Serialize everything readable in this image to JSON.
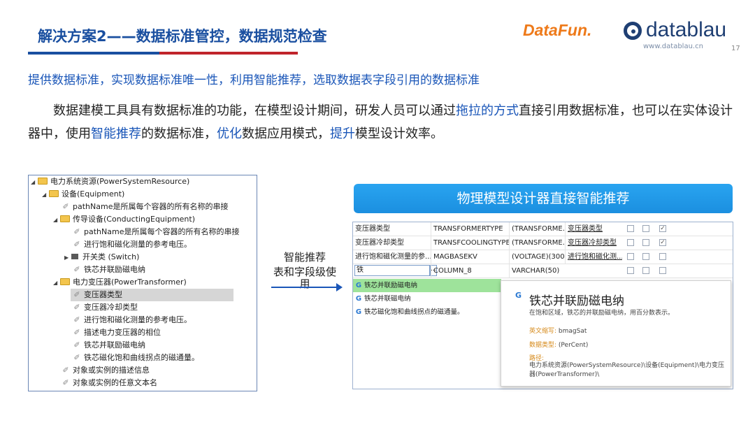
{
  "header": {
    "title": "解决方案2——数据标准管控，数据规范检查",
    "logo_datafun": "DataFun.",
    "logo_datablau": "datablau",
    "logo_url": "www.datablau.cn",
    "page_number": "17"
  },
  "subtitle": "提供数据标准，实现数据标准唯一性，利用智能推荐，选取数据表字段引用的数据标准",
  "paragraph": {
    "p1": "数据建模工具具有数据标准的功能，在模型设计期间，研发人员可以通过",
    "h1": "拖拉的方式",
    "p2": "直接引用数据标准，也可以在实体设计器中，使用",
    "h2": "智能推荐",
    "p3": "的数据标准，",
    "h3": "优化",
    "p4": "数据应用模式，",
    "h4": "提升",
    "p5": "模型设计效率。"
  },
  "tree": {
    "items": [
      {
        "label": "电力系统资源(PowerSystemResource)",
        "type": "folder",
        "expanded": true
      },
      {
        "label": "设备(Equipment)",
        "type": "folder",
        "expanded": true
      },
      {
        "label": "pathName是所属每个容器的所有名称的串接",
        "type": "leaf"
      },
      {
        "label": "传导设备(ConductingEquipment)",
        "type": "folder",
        "expanded": true
      },
      {
        "label": "pathName是所属每个容器的所有名称的串接",
        "type": "leaf"
      },
      {
        "label": "进行饱和磁化测量的参考电压。",
        "type": "leaf"
      },
      {
        "label": "开关类 (Switch)",
        "type": "folder-collapsed"
      },
      {
        "label": "铁芯并联励磁电纳",
        "type": "leaf"
      },
      {
        "label": "电力变压器(PowerTransformer)",
        "type": "folder",
        "expanded": true
      },
      {
        "label": "变压器类型",
        "type": "leaf",
        "selected": true
      },
      {
        "label": "变压器冷却类型",
        "type": "leaf"
      },
      {
        "label": "进行饱和磁化测量的参考电压。",
        "type": "leaf"
      },
      {
        "label": "描述电力变压器的相位",
        "type": "leaf"
      },
      {
        "label": "铁芯并联励磁电纳",
        "type": "leaf"
      },
      {
        "label": "铁芯磁化饱和曲线拐点的磁通量。",
        "type": "leaf"
      },
      {
        "label": "对象或实例的描述信息",
        "type": "leaf"
      },
      {
        "label": "对象或实例的任意文本名",
        "type": "leaf"
      }
    ]
  },
  "middle": {
    "line1": "智能推荐",
    "line2": "表和字段级使",
    "line3": "用"
  },
  "banner": "物理模型设计器直接智能推荐",
  "grid": {
    "rows": [
      {
        "name": "变压器类型",
        "column": "TRANSFORMERTYPE",
        "datatype": "(TRANSFORME...",
        "standard": "变压器类型",
        "c1": false,
        "c2": false,
        "c3": true
      },
      {
        "name": "变压器冷却类型",
        "column": "TRANSFCOOLINGTYPE",
        "datatype": "(TRANSFORME...",
        "standard": "变压器冷却类型",
        "c1": false,
        "c2": false,
        "c3": true
      },
      {
        "name": "进行饱和磁化测量的参...",
        "column": "MAGBASEKV",
        "datatype": "(VOLTAGE)(300)",
        "standard": "进行饱和磁化测...",
        "c1": false,
        "c2": false,
        "c3": false
      },
      {
        "name": "铁",
        "column": "COLUMN_8",
        "datatype": "VARCHAR(50)",
        "standard": "",
        "c1": false,
        "c2": false,
        "c3": false
      }
    ],
    "dropdown_glyph": "..."
  },
  "suggestions": {
    "items": [
      {
        "icon": "G",
        "label": "铁芯并联励磁电纳"
      },
      {
        "icon": "G",
        "label": "铁芯并联磁电纳"
      },
      {
        "icon": "G",
        "label": "铁芯磁化饱和曲线拐点的磁通量。"
      }
    ]
  },
  "popup": {
    "icon": "G",
    "title": "铁芯并联励磁电纳",
    "description": "在饱和区域，铁芯的并联励磁电纳，用百分数表示。",
    "abbr_key": "英文缩写:",
    "abbr_val": "bmagSat",
    "dtype_key": "数据类型:",
    "dtype_val": "(PerCent)",
    "path_key": "路径:",
    "path_val": "电力系统资源(PowerSystemResource)\\设备(Equipment)\\电力变压器(PowerTransformer)\\"
  },
  "colors": {
    "title_blue": "#1a4fa0",
    "accent_red": "#c0242b",
    "highlight_blue": "#1a56b8",
    "banner": "#1b8fe0",
    "suggestion_active": "#9ee39b"
  }
}
